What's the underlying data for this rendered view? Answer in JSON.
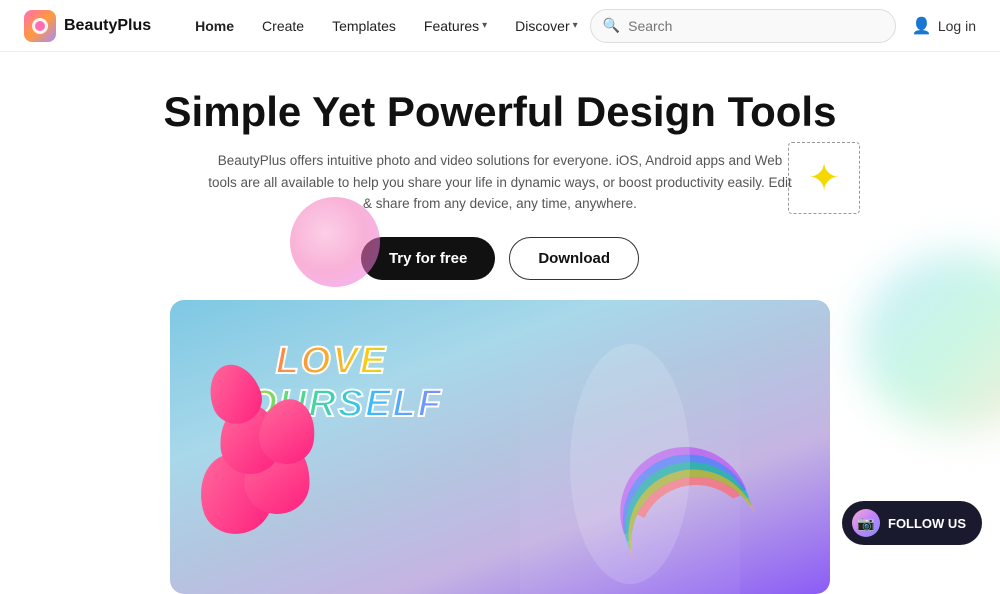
{
  "nav": {
    "logo_text": "BeautyPlus",
    "links": [
      {
        "label": "Home",
        "active": true,
        "has_dropdown": false
      },
      {
        "label": "Create",
        "has_dropdown": false
      },
      {
        "label": "Templates",
        "has_dropdown": false
      },
      {
        "label": "Features",
        "has_dropdown": true
      },
      {
        "label": "Discover",
        "has_dropdown": true
      }
    ],
    "search_placeholder": "Search",
    "login_label": "Log in"
  },
  "hero": {
    "title": "Simple Yet Powerful Design Tools",
    "subtitle": "BeautyPlus offers intuitive photo and video solutions for everyone. iOS, Android apps and Web tools are all available to help you share your life in dynamic ways, or boost productivity easily. Edit & share from any device, any time, anywhere.",
    "btn_primary": "Try for free",
    "btn_secondary": "Download"
  },
  "overlay": {
    "line1": "LOVE",
    "line2": "YOURSELF"
  },
  "follow": {
    "label": "FOLLOW US"
  }
}
